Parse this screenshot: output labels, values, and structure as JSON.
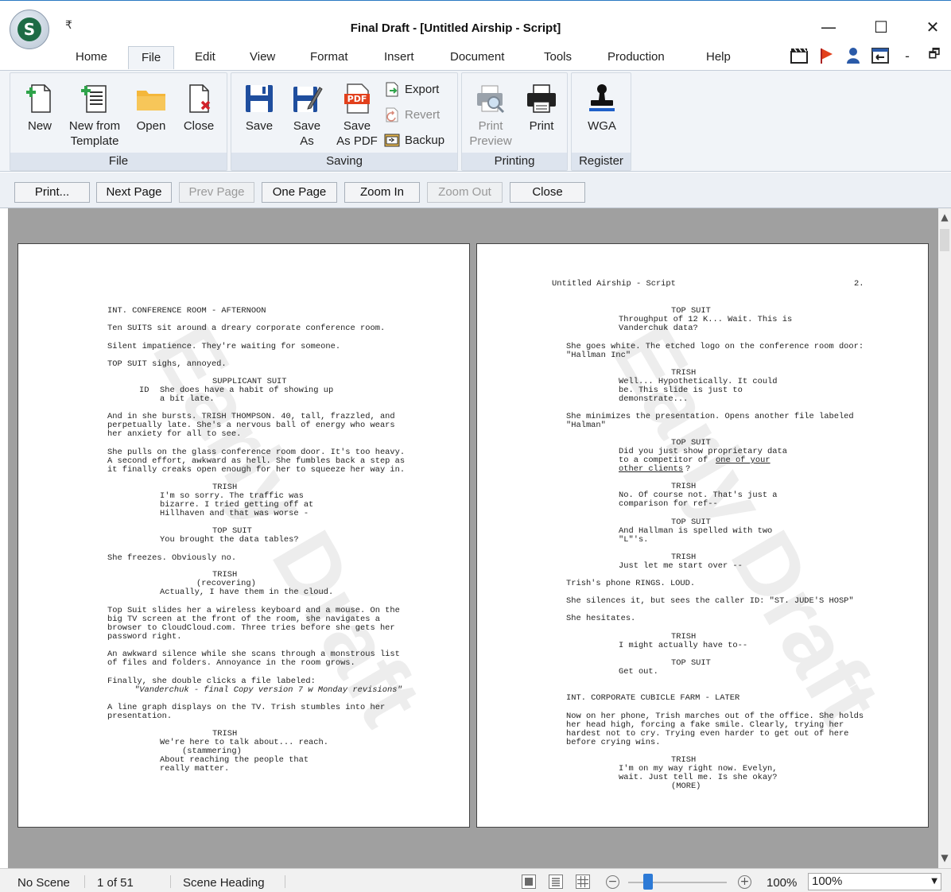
{
  "window": {
    "title": "Final Draft - [Untitled Airship - Script]",
    "qat_symbol": "₹",
    "min_symbol": "—",
    "max_symbol": "☐",
    "close_symbol": "✕"
  },
  "menu": {
    "tabs": [
      "Home",
      "File",
      "Edit",
      "View",
      "Format",
      "Insert",
      "Document",
      "Tools",
      "Production",
      "Help"
    ],
    "active_tab": "File",
    "right_icons": [
      "clapper-icon",
      "flag-icon",
      "person-icon",
      "sidebar-icon",
      "minimize-ribbon-icon",
      "restore-icon",
      "close-doc-icon"
    ],
    "right_symbols": [
      "▭",
      "▶",
      "●",
      "⇤",
      "-",
      "🗗",
      "×"
    ]
  },
  "ribbon": {
    "file_group": {
      "label": "File",
      "new": "New",
      "new_from_template_1": "New from",
      "new_from_template_2": "Template",
      "open": "Open",
      "close": "Close"
    },
    "saving_group": {
      "label": "Saving",
      "save": "Save",
      "save_as_1": "Save",
      "save_as_2": "As",
      "save_pdf_1": "Save",
      "save_pdf_2": "As PDF",
      "pdf_badge": "PDF",
      "export": "Export",
      "revert": "Revert",
      "backup": "Backup"
    },
    "printing_group": {
      "label": "Printing",
      "print_preview_1": "Print",
      "print_preview_2": "Preview",
      "print": "Print"
    },
    "register_group": {
      "label": "Register",
      "wga": "WGA"
    }
  },
  "preview_toolbar": {
    "print": "Print...",
    "next_page": "Next Page",
    "prev_page": "Prev Page",
    "one_page": "One Page",
    "zoom_in": "Zoom In",
    "zoom_out": "Zoom Out",
    "close": "Close"
  },
  "pages": {
    "watermark": "Early Draft",
    "left": [
      "INT. CONFERENCE ROOM - AFTERNOON",
      "Ten SUITS sit around a dreary corporate conference room.",
      "Silent impatience. They're waiting for someone.",
      "TOP SUIT sighs, annoyed.",
      "SUPPLICANT SUIT",
      "She does have a habit of showing up",
      "a bit late.",
      "And in she bursts. TRISH THOMPSON. 40, tall, frazzled, and",
      "perpetually late. She's a nervous ball of energy who wears",
      "her anxiety for all to see.",
      "She pulls on the glass conference room door. It's too heavy.",
      "A second effort, awkward as hell. She fumbles back a step as",
      "it finally creaks open enough for her to squeeze her way in.",
      "TRISH",
      "I'm so sorry. The traffic was",
      "bizarre. I tried getting off at",
      "Hillhaven and that was worse -",
      "TOP SUIT",
      "You brought the data tables?",
      "She freezes. Obviously no.",
      "TRISH",
      "(recovering)",
      "Actually, I have them in the cloud.",
      "Top Suit slides her a wireless keyboard and a mouse. On the",
      "big TV screen at the front of the room, she navigates a",
      "browser to CloudCloud.com. Three tries before she gets her",
      "password right.",
      "An awkward silence while she scans through a monstrous list",
      "of files and folders. Annoyance in the room grows.",
      "Finally, she double clicks a file labeled:",
      "\"Vanderchuk - final Copy version 7 w Monday revisions\"",
      "A line graph displays on the TV. Trish stumbles into her",
      "presentation.",
      "TRISH",
      "We're here to talk about... reach.",
      "(stammering)",
      "About reaching the people that",
      "really matter.",
      "ID"
    ],
    "right": [
      "Untitled Airship - Script",
      "2.",
      "TOP SUIT",
      "Throughput of 12 K... Wait. This is",
      "Vanderchuk data?",
      "She goes white. The etched logo on the conference room door:",
      "\"Hallman Inc\"",
      "TRISH",
      "Well... Hypothetically. It could",
      "be. This slide is just to",
      "demonstrate...",
      "She minimizes the presentation. Opens another file labeled",
      "\"Halman\"",
      "TOP SUIT",
      "Did you just show proprietary data",
      "to a competitor of ",
      "one of your",
      "other clients",
      "?",
      "TRISH",
      "No. Of course not. That's just a",
      "comparison for ref--",
      "TOP SUIT",
      "And Hallman is spelled with two",
      "\"L\"'s.",
      "TRISH",
      "Just let me start over --",
      "Trish's phone RINGS. LOUD.",
      "She silences it, but sees the caller ID: \"ST. JUDE'S HOSP\"",
      "She hesitates.",
      "TRISH",
      "I might actually have to--",
      "TOP SUIT",
      "Get out.",
      "INT. CORPORATE CUBICLE FARM - LATER",
      "Now on her phone, Trish marches out of the office. She holds",
      "her head high, forcing a fake smile. Clearly, trying her",
      "hardest not to cry. Trying even harder to get out of here",
      "before crying wins.",
      "TRISH",
      "I'm on my way right now. Evelyn,",
      "wait. Just tell me. Is she okay?",
      "(MORE)"
    ]
  },
  "status": {
    "scene": "No Scene",
    "page_info": "1  of  51",
    "element": "Scene Heading",
    "zoom_minus": "−",
    "zoom_plus": "+",
    "zoom_percent": "100%",
    "zoom_select": "100%",
    "zoom_level": 0.2
  },
  "colors": {
    "accent": "#2d7ad6",
    "ribbon_bg": "#f1f4f8",
    "preview_bg": "#a0a0a0",
    "flag": "#e2401c"
  }
}
